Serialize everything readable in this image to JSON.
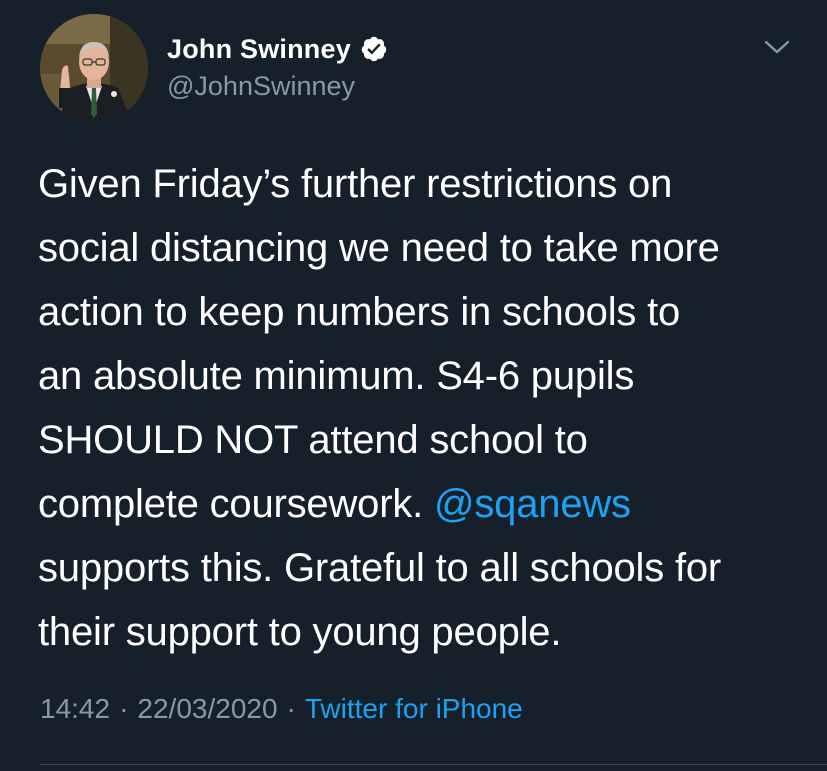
{
  "author": {
    "display_name": "John Swinney",
    "handle": "@JohnSwinney",
    "verified": true,
    "avatar_icon": "profile-photo"
  },
  "tweet": {
    "text_before_mention": "Given Friday’s further restrictions on\nsocial distancing we need to take more\naction to keep numbers in schools to\nan absolute minimum. S4-6 pupils\nSHOULD NOT attend school to\ncomplete coursework. ",
    "mention": "@sqanews",
    "text_after_mention": "\nsupports this. Grateful to all schools for\ntheir support to young people."
  },
  "meta": {
    "time": "14:42",
    "separator": "·",
    "date": "22/03/2020",
    "source": "Twitter for iPhone"
  },
  "colors": {
    "background": "#15202b",
    "primary_text": "#ffffff",
    "secondary_text": "#8899a6",
    "accent": "#1da1f2"
  },
  "icons": {
    "verified": "verified-badge-icon",
    "menu": "chevron-down-icon"
  }
}
